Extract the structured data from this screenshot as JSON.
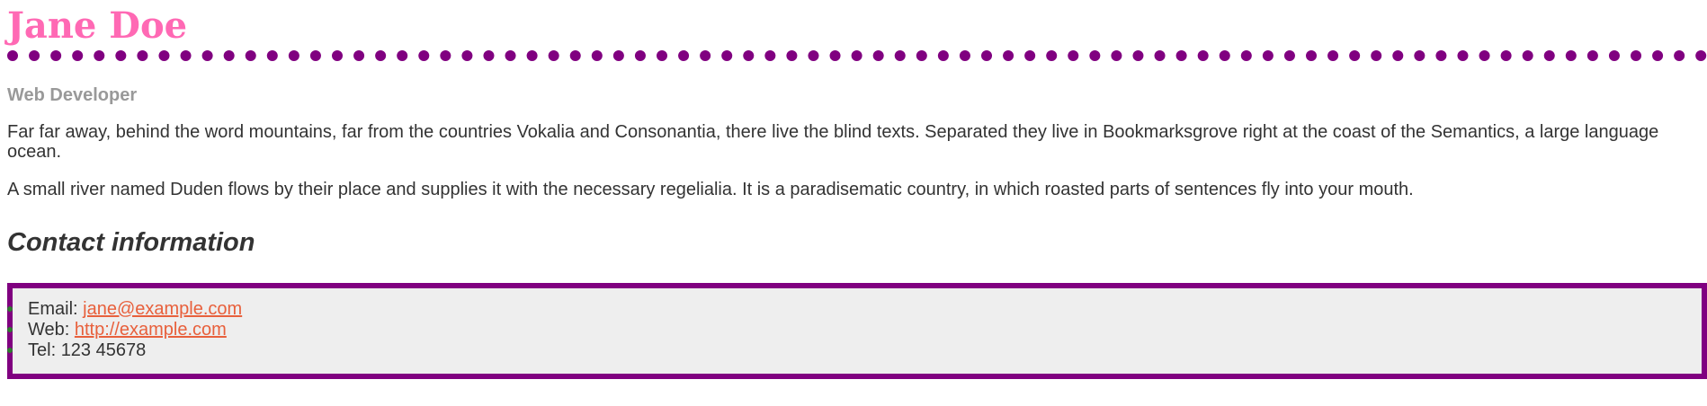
{
  "profile": {
    "name": "Jane Doe",
    "role": "Web Developer"
  },
  "bio": {
    "paragraph1": "Far far away, behind the word mountains, far from the countries Vokalia and Consonantia, there live the blind texts. Separated they live in Bookmarksgrove right at the coast of the Semantics, a large language ocean.",
    "paragraph2": "A small river named Duden flows by their place and supplies it with the necessary regelialia. It is a paradisematic country, in which roasted parts of sentences fly into your mouth."
  },
  "contact": {
    "heading": "Contact information",
    "email_label": "Email: ",
    "email_value": "jane@example.com",
    "web_label": "Web: ",
    "web_value": "http://example.com",
    "tel_label": "Tel: ",
    "tel_value": "123 45678"
  },
  "colors": {
    "name": "#ff69b4",
    "accent": "#800080",
    "link": "#e8603c",
    "role": "#999999",
    "box_bg": "#eeeeee"
  }
}
